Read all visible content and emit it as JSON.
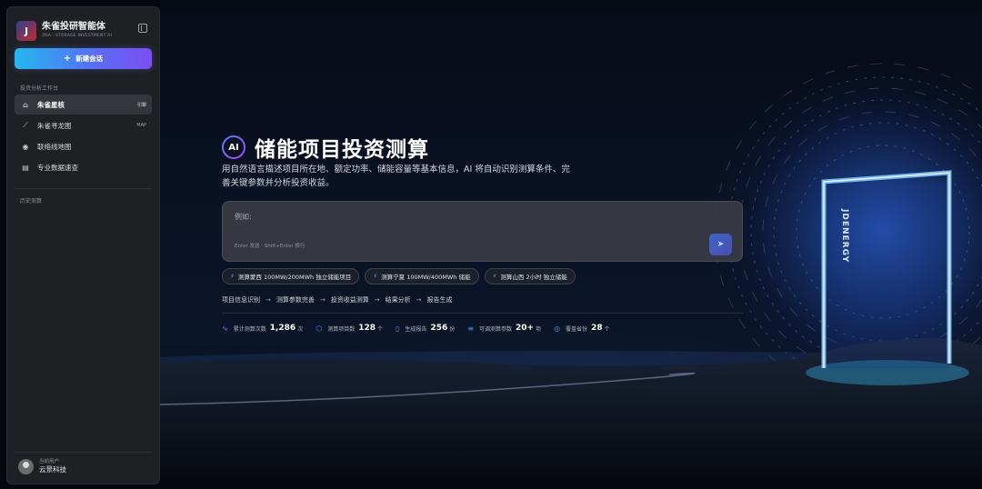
{
  "brand": {
    "logo_glyph": "J",
    "name": "朱雀投研智能体",
    "subtitle": "ZNA · STORAGE INVESTMENT AI"
  },
  "sidebar": {
    "new_button_label": "新建会话",
    "section_label": "投资分析工作台",
    "items": [
      {
        "label": "朱雀星核",
        "tag": "引擎",
        "icon": "home-icon"
      },
      {
        "label": "朱雀寻龙图",
        "tag": "MAP",
        "icon": "chart-line-icon"
      },
      {
        "label": "联络线地图",
        "tag": "",
        "icon": "eye-icon"
      },
      {
        "label": "专业数据速查",
        "tag": "",
        "icon": "document-icon"
      }
    ],
    "history_label": "历史测算",
    "user": {
      "role": "当前用户",
      "name": "云景科技"
    }
  },
  "main": {
    "ai_badge": "AI",
    "title": "储能项目投资测算",
    "description": "用自然语言描述项目所在地、额定功率、储能容量等基本信息，AI 将自动识别测算条件、完善关键参数并分析投资收益。",
    "input": {
      "placeholder": "例如:",
      "hint": "Enter 发送 · Shift+Enter 换行"
    },
    "chips": [
      "测算蒙西 100MW/200MWh 独立储能项目",
      "测算宁夏 100MW/400MWh 储能",
      "测算山西 2小时 独立储能"
    ],
    "steps": [
      "项目信息识别",
      "测算参数完善",
      "投资收益测算",
      "结果分析",
      "报告生成"
    ],
    "stats": [
      {
        "label": "累计测算次数",
        "value": "1,286",
        "unit": "次",
        "icon": "activity-icon"
      },
      {
        "label": "测算项目数",
        "value": "128",
        "unit": "个",
        "icon": "cube-icon"
      },
      {
        "label": "生成报告",
        "value": "256",
        "unit": "份",
        "icon": "file-icon"
      },
      {
        "label": "可调测算参数",
        "value": "20+",
        "unit": "项",
        "icon": "sliders-icon"
      },
      {
        "label": "覆盖省份",
        "value": "28",
        "unit": "个",
        "icon": "map-pin-icon"
      }
    ]
  },
  "hero": {
    "portal_text": "JDENERGY"
  },
  "colors": {
    "accent": "#4f7cf5",
    "portal": "#6fb8ff",
    "bolt": "#55a6ff"
  }
}
